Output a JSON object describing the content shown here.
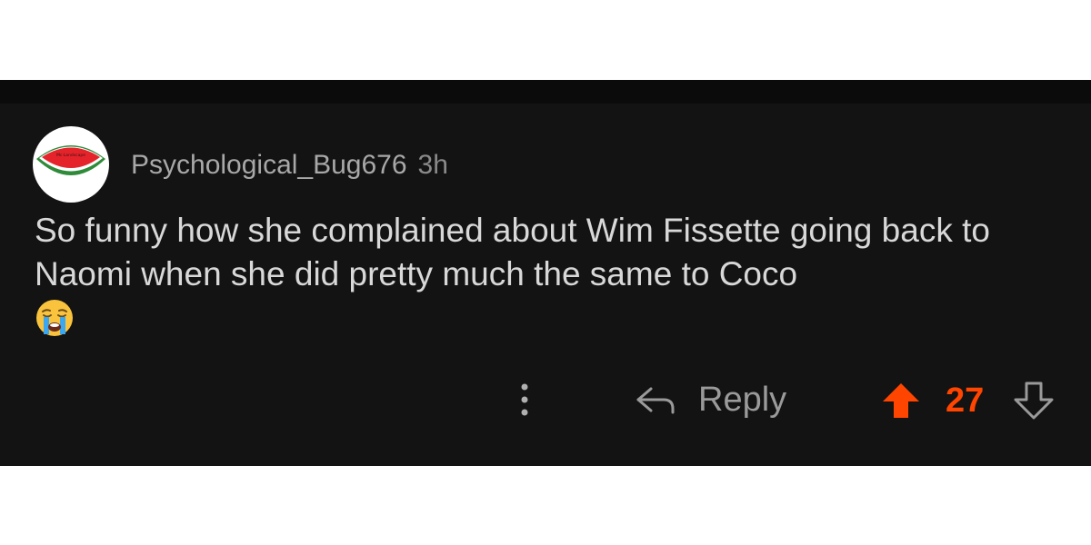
{
  "comment": {
    "author": "Psychological_Bug676",
    "age": "3h",
    "body": "So funny how she complained about Wim Fissette going back to Naomi when she did pretty much the same to Coco",
    "avatar_icon": "watermelon-avatar-icon",
    "avatar_watermark": "Mc·Landscape"
  },
  "actions": {
    "more_icon": "vertical-ellipsis-icon",
    "reply_icon": "reply-arrow-icon",
    "reply_label": "Reply",
    "upvote_icon": "upvote-arrow-icon",
    "vote_count": "27",
    "downvote_icon": "downvote-arrow-icon"
  },
  "colors": {
    "background": "#131313",
    "upvote_active": "#ff4500",
    "text_primary": "#d8d8d8",
    "text_muted": "#a8a8a8"
  }
}
